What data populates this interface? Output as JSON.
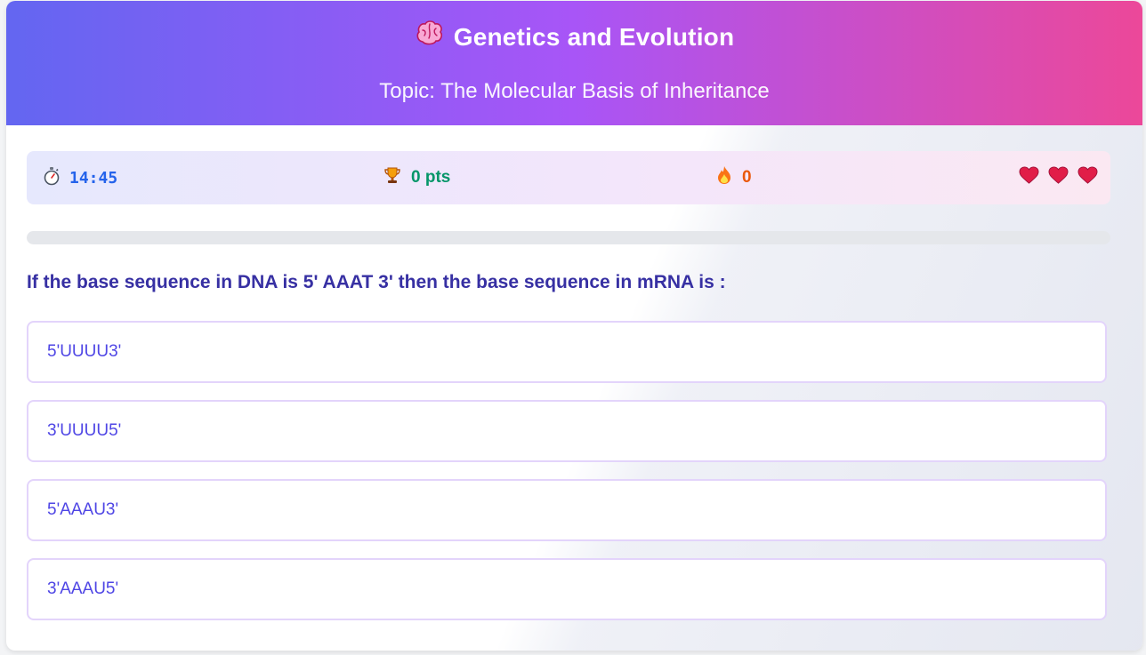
{
  "header": {
    "icon": "brain-icon",
    "title": "Genetics and Evolution",
    "subtitle": "Topic: The Molecular Basis of Inheritance"
  },
  "stats": {
    "timer": "14:45",
    "timer_icon": "stopwatch-icon",
    "points": "0 pts",
    "points_icon": "trophy-icon",
    "streak": "0",
    "streak_icon": "fire-icon",
    "lives_icon": "heart-icon",
    "lives": 3
  },
  "progress": {
    "fraction": 0
  },
  "question": {
    "text": "If the base sequence in DNA is 5' AAAT 3' then the base sequence in mRNA is :",
    "options": [
      "5'UUUU3'",
      "3'UUUU5'",
      "5'AAAU3'",
      "3'AAAU5'"
    ]
  },
  "colors": {
    "header_gradient": [
      "#6366f1",
      "#a855f7",
      "#ec4899"
    ],
    "timer": "#2563eb",
    "points": "#059669",
    "streak": "#ea580c",
    "question": "#3730a3",
    "option_text": "#4f46e5",
    "option_border": "#e3d4fb",
    "heart": "#e11d48"
  }
}
